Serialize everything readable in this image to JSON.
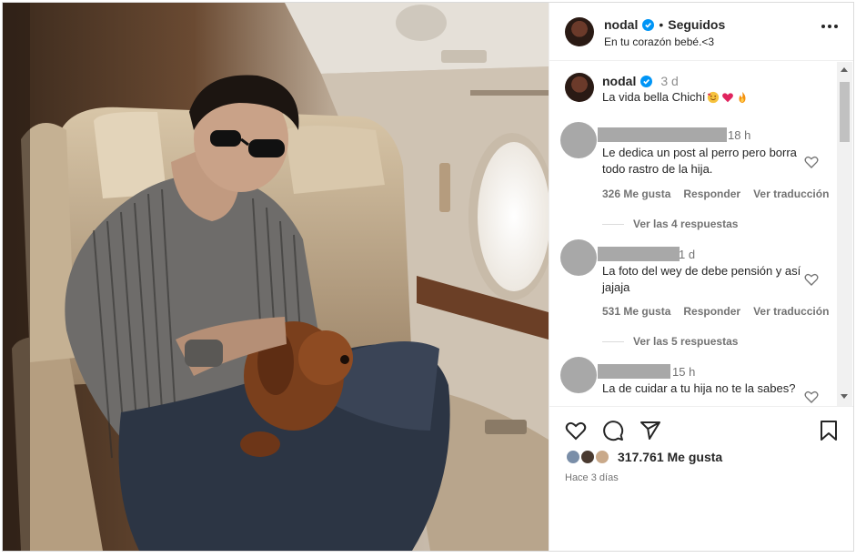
{
  "post": {
    "username": "nodal",
    "follow_state": "Seguidos",
    "separator": "•",
    "subtitle": "En tu corazón bebé.<3",
    "caption_username": "nodal",
    "caption_time": "3 d",
    "caption_text": "La vida bella Chichí",
    "caption_emojis": [
      "smiling-face-with-hearts",
      "red-heart",
      "fire"
    ]
  },
  "comments": [
    {
      "time": "18 h",
      "text": "Le dedica un post al perro pero borra todo rastro de la hija.",
      "likes": "326 Me gusta",
      "reply": "Responder",
      "translate": "Ver traducción",
      "replies": "Ver las 4 respuestas"
    },
    {
      "time": "1 d",
      "text": "La foto del wey de debe pensión y así jajaja",
      "likes": "531 Me gusta",
      "reply": "Responder",
      "translate": "Ver traducción",
      "replies": "Ver las 5 respuestas"
    },
    {
      "time": "15 h",
      "text": "La de cuidar a tu hija no te la sabes?"
    }
  ],
  "actions": {
    "likes_count": "317.761 Me gusta",
    "posted_ago": "Hace 3 días"
  },
  "icons": [
    "more-options-icon",
    "verified-badge-icon",
    "heart-icon",
    "comment-icon",
    "share-icon",
    "bookmark-icon"
  ],
  "colors": {
    "verified": "#0095f6",
    "secondary_text": "#737373",
    "redaction": "#a8a8a8"
  }
}
